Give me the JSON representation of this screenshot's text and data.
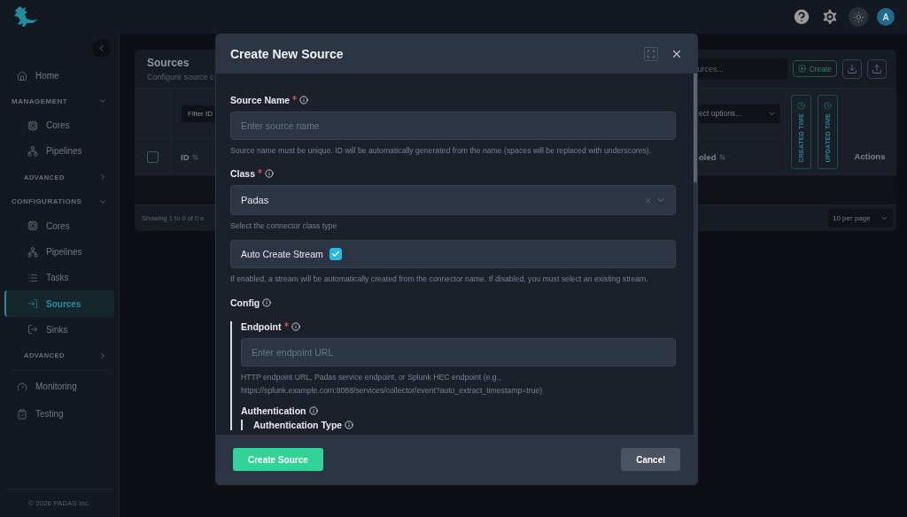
{
  "topbar": {
    "avatar": "A"
  },
  "sidebar": {
    "items": [
      {
        "kind": "link",
        "label": "Home",
        "selected": false
      },
      {
        "kind": "section",
        "label": "MANAGEMENT",
        "expanded": true,
        "children": [
          {
            "kind": "link",
            "label": "Cores",
            "selected": false
          },
          {
            "kind": "link",
            "label": "Pipelines",
            "selected": false
          },
          {
            "kind": "subsection",
            "label": "ADVANCED",
            "expanded": false
          }
        ]
      },
      {
        "kind": "section",
        "label": "CONFIGURATIONS",
        "expanded": true,
        "children": [
          {
            "kind": "link",
            "label": "Cores",
            "selected": false
          },
          {
            "kind": "link",
            "label": "Pipelines",
            "selected": false
          },
          {
            "kind": "link",
            "label": "Tasks",
            "selected": false
          },
          {
            "kind": "link",
            "label": "Sources",
            "selected": true
          },
          {
            "kind": "link",
            "label": "Sinks",
            "selected": false
          },
          {
            "kind": "subsection",
            "label": "ADVANCED",
            "expanded": false
          }
        ]
      },
      {
        "kind": "link",
        "label": "Monitoring",
        "selected": false
      },
      {
        "kind": "link",
        "label": "Testing",
        "selected": false
      }
    ],
    "footer": "© 2026 PADAS Inc."
  },
  "page": {
    "title": "Sources",
    "subtitle": "Configure source c",
    "search_placeholder": "urces...",
    "create_label": "Create",
    "filter_placeholder": "Filter ID",
    "select_placeholder": "ect options...",
    "select_all_checked": false,
    "columns": [
      {
        "label": "ID"
      },
      {
        "label": "oled"
      }
    ],
    "time_columns": [
      "CREATED TIME",
      "UPDATED TIME"
    ],
    "actions_label": "Actions",
    "showing": "Showing 1 to 0 of 0 e",
    "per_page": "10 per page"
  },
  "modal": {
    "title": "Create New Source",
    "fields": [
      {
        "kind": "text",
        "label": "Source Name",
        "required": true,
        "placeholder": "Enter source name",
        "help": "Source name must be unique. ID will be automatically generated from the name (spaces will be replaced with underscores)."
      },
      {
        "kind": "select",
        "label": "Class",
        "required": true,
        "value": "Padas",
        "help": "Select the connector class type"
      },
      {
        "kind": "checkbox",
        "label": "Auto Create Stream",
        "checked": true,
        "help": "If enabled, a stream will be automatically created from the connector name. If disabled, you must select an existing stream."
      },
      {
        "kind": "group",
        "label": "Config",
        "children": [
          {
            "kind": "text",
            "label": "Endpoint",
            "required": true,
            "placeholder": "Enter endpoint URL",
            "help": "HTTP endpoint URL, Padas service endpoint, or Splunk HEC endpoint (e.g., https://splunk.example.com:8088/services/collector/event?auto_extract_timestamp=true)"
          },
          {
            "kind": "group",
            "label": "Authentication",
            "children": [
              {
                "kind": "label",
                "label": "Authentication Type"
              }
            ]
          }
        ]
      }
    ],
    "buttons": [
      {
        "label": "Create Source",
        "kind": "primary"
      },
      {
        "label": "Cancel",
        "kind": "secondary"
      }
    ]
  }
}
